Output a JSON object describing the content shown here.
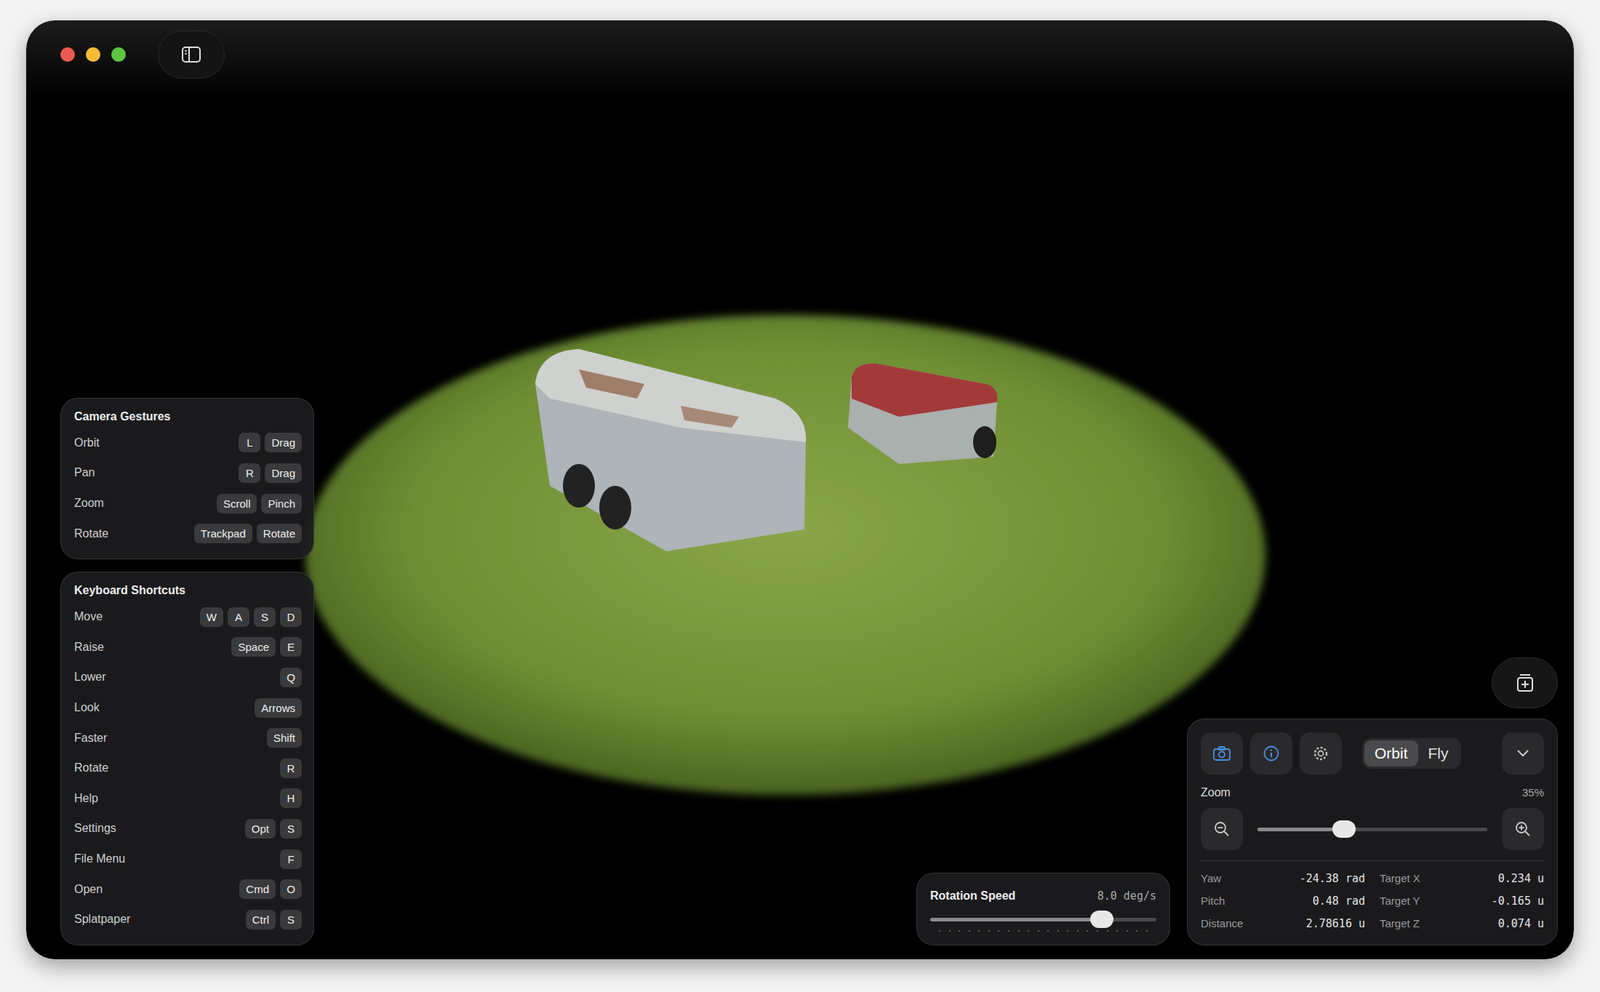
{
  "camera_gestures": {
    "title": "Camera Gestures",
    "rows": [
      {
        "label": "Orbit",
        "keys": [
          "L",
          "Drag"
        ]
      },
      {
        "label": "Pan",
        "keys": [
          "R",
          "Drag"
        ]
      },
      {
        "label": "Zoom",
        "keys": [
          "Scroll",
          "Pinch"
        ]
      },
      {
        "label": "Rotate",
        "keys": [
          "Trackpad",
          "Rotate"
        ]
      }
    ]
  },
  "keyboard_shortcuts": {
    "title": "Keyboard Shortcuts",
    "rows": [
      {
        "label": "Move",
        "keys": [
          "W",
          "A",
          "S",
          "D"
        ]
      },
      {
        "label": "Raise",
        "keys": [
          "Space",
          "E"
        ]
      },
      {
        "label": "Lower",
        "keys": [
          "Q"
        ]
      },
      {
        "label": "Look",
        "keys": [
          "Arrows"
        ]
      },
      {
        "label": "Faster",
        "keys": [
          "Shift"
        ]
      },
      {
        "label": "Rotate",
        "keys": [
          "R"
        ]
      },
      {
        "label": "Help",
        "keys": [
          "H"
        ]
      },
      {
        "label": "Settings",
        "keys": [
          "Opt",
          "S"
        ]
      },
      {
        "label": "File Menu",
        "keys": [
          "F"
        ]
      },
      {
        "label": "Open",
        "keys": [
          "Cmd",
          "O"
        ]
      },
      {
        "label": "Splatpaper",
        "keys": [
          "Ctrl",
          "S"
        ]
      }
    ]
  },
  "rotation_speed": {
    "label": "Rotation Speed",
    "reading": "8.0 deg/s",
    "level": 0.76
  },
  "view_panel": {
    "tools": [
      {
        "kind": "camera",
        "active": true
      },
      {
        "kind": "info",
        "active": true
      },
      {
        "kind": "settings",
        "active": false
      }
    ],
    "modes": [
      {
        "label": "Orbit",
        "selected": true
      },
      {
        "label": "Fly",
        "selected": false
      }
    ],
    "zoom": {
      "label": "Zoom",
      "reading": "35%",
      "level": 0.375
    },
    "readouts": [
      {
        "label": "Yaw",
        "value": "-24.38 rad"
      },
      {
        "label": "Target X",
        "value": "0.234 u"
      },
      {
        "label": "Pitch",
        "value": "0.48 rad"
      },
      {
        "label": "Target Y",
        "value": "-0.165 u"
      },
      {
        "label": "Distance",
        "value": "2.78616 u"
      },
      {
        "label": "Target Z",
        "value": "0.074 u"
      }
    ]
  }
}
